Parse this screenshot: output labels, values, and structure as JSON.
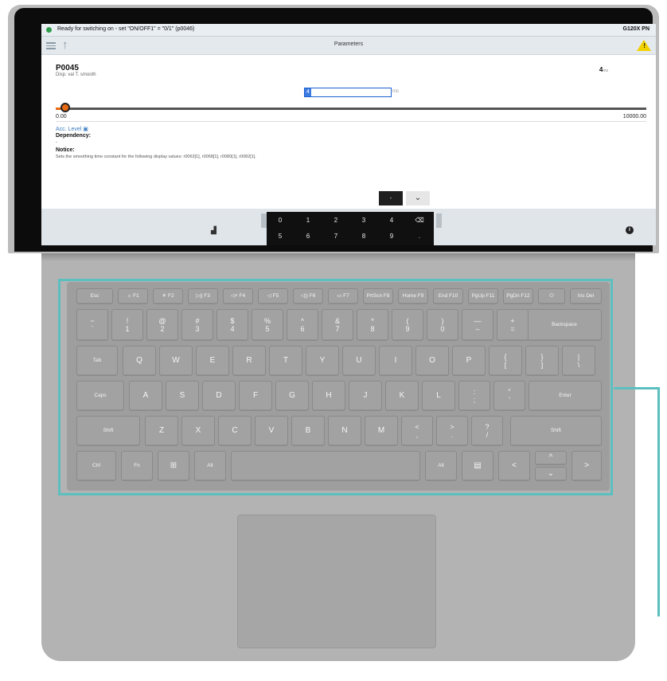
{
  "screen": {
    "status_text": "Ready for switching on - set \"ON/OFF1\" = \"0/1\" (p0046)",
    "device_name": "G120X PN",
    "toolbar_title": "Parameters",
    "warning_mark": "!",
    "param": {
      "id": "P0045",
      "description": "Disp. val T. smooth",
      "value": "4",
      "unit": "ms"
    },
    "input": {
      "value": "4",
      "unit": "ms"
    },
    "slider": {
      "min": "0.00",
      "max": "10000.00",
      "level_fraction": 0.0004
    },
    "access_level": "Acc. Level",
    "dependency_heading": "Dependency:",
    "dependency_value": "-",
    "notice_heading": "Notice:",
    "notice_text": "Sets the smoothing time constant for the following display values: r0063[1], r0068[1], r0080[1], r0082[1].",
    "keypad": {
      "top_keys": [
        "-",
        "⌄"
      ],
      "row1": [
        "0",
        "1",
        "2",
        "3",
        "4",
        "⌫"
      ],
      "row2": [
        "5",
        "6",
        "7",
        "8",
        "9",
        "."
      ]
    },
    "info_mark": "i"
  },
  "keyboard": {
    "fn_row": [
      "Esc",
      "☼ F1",
      "☀ F2",
      "▷|| F3",
      "◁× F4",
      "◁ F5",
      "◁)) F6",
      "▭ F7",
      "PrtScn F8",
      "Home F9",
      "End F10",
      "PgUp F11",
      "PgDn F12",
      "⏻",
      "Ins Del"
    ],
    "number_row": [
      {
        "top": "~",
        "bottom": "`"
      },
      {
        "top": "!",
        "bottom": "1"
      },
      {
        "top": "@",
        "bottom": "2"
      },
      {
        "top": "#",
        "bottom": "3"
      },
      {
        "top": "$",
        "bottom": "4"
      },
      {
        "top": "%",
        "bottom": "5"
      },
      {
        "top": "^",
        "bottom": "6"
      },
      {
        "top": "&",
        "bottom": "7"
      },
      {
        "top": "*",
        "bottom": "8"
      },
      {
        "top": "(",
        "bottom": "9"
      },
      {
        "top": ")",
        "bottom": "0"
      },
      {
        "top": "—",
        "bottom": "–"
      },
      {
        "top": "+",
        "bottom": "="
      }
    ],
    "backspace": "Backspace",
    "tab": "Tab",
    "qwerty": [
      "Q",
      "W",
      "E",
      "R",
      "T",
      "Y",
      "U",
      "I",
      "O",
      "P"
    ],
    "bracket_keys": [
      {
        "top": "{",
        "bottom": "["
      },
      {
        "top": "}",
        "bottom": "]"
      },
      {
        "top": "|",
        "bottom": "\\"
      }
    ],
    "caps": "Caps",
    "home_row": [
      "A",
      "S",
      "D",
      "F",
      "G",
      "H",
      "J",
      "K",
      "L"
    ],
    "home_symbols": [
      {
        "top": ":",
        "bottom": ";"
      },
      {
        "top": "\"",
        "bottom": "'"
      }
    ],
    "enter": "Enter",
    "shift_left": "Shift",
    "bottom_row": [
      "Z",
      "X",
      "C",
      "V",
      "B",
      "N",
      "M"
    ],
    "bottom_symbols": [
      {
        "top": "<",
        "bottom": ","
      },
      {
        "top": ">",
        "bottom": "."
      },
      {
        "top": "?",
        "bottom": "/"
      }
    ],
    "shift_right": "Shift",
    "ctrl": "Ctrl",
    "fn": "Fn",
    "win": "⊞",
    "alt_left": "Alt",
    "alt_right": "Alt",
    "menu": "▤",
    "arrows": {
      "left": "<",
      "up": "^",
      "down": "⌄",
      "right": ">"
    }
  },
  "colors": {
    "highlight": "#5cbfbf",
    "slider": "#e86a12",
    "warning": "#f2d100"
  }
}
